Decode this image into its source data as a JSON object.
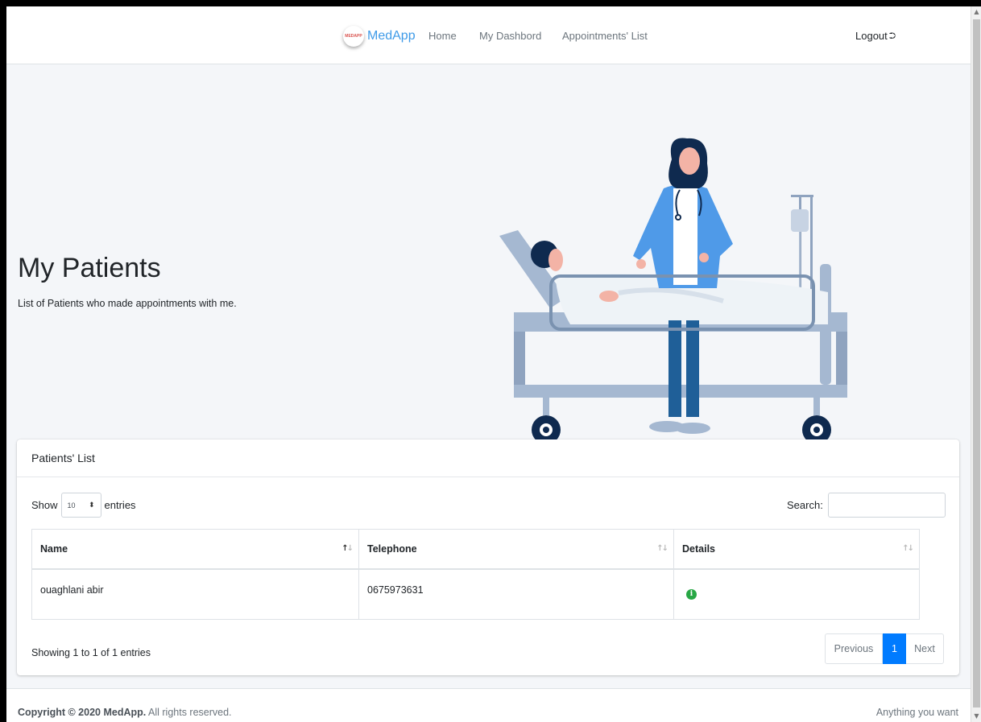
{
  "navbar": {
    "brand_logo_text": "MEDAPP",
    "brand_name": "MedApp",
    "links": [
      "Home",
      "My Dashbord",
      "Appointments' List"
    ],
    "logout_label": "Logout"
  },
  "hero": {
    "title": "My Patients",
    "subtitle": "List of Patients who made appointments with me."
  },
  "card": {
    "header": "Patients' List",
    "length": {
      "show_label": "Show",
      "value": "10",
      "entries_label": "entries"
    },
    "search": {
      "label": "Search:",
      "value": ""
    },
    "table": {
      "columns": [
        "Name",
        "Telephone",
        "Details"
      ],
      "rows": [
        {
          "name": "ouaghlani abir",
          "telephone": "0675973631",
          "details_icon": "info-icon"
        }
      ]
    },
    "info": "Showing 1 to 1 of 1 entries",
    "pagination": {
      "previous": "Previous",
      "current": "1",
      "next": "Next"
    }
  },
  "footer": {
    "copyright_prefix": "Copyright © 2020 MedApp.",
    "copyright_suffix": " All rights reserved.",
    "right_text": "Anything you want"
  },
  "colors": {
    "brand": "#3f9be8",
    "page_bg": "#f4f6f9",
    "primary": "#007bff",
    "success": "#28a745"
  }
}
